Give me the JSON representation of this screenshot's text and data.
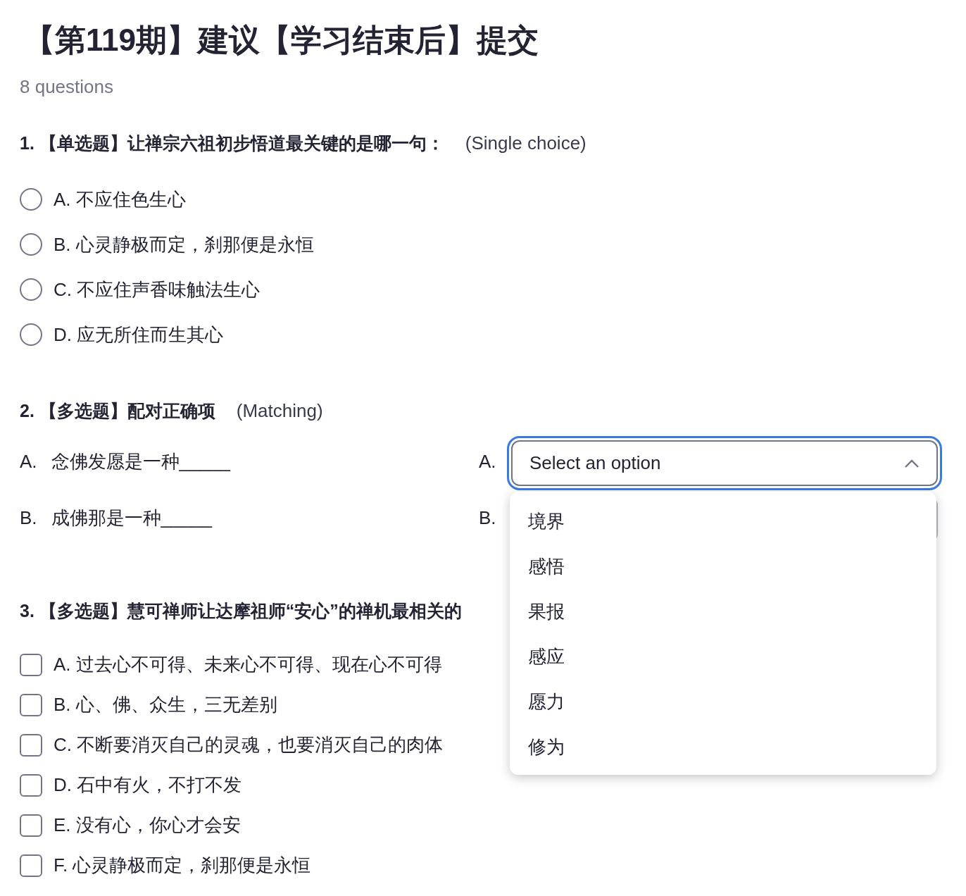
{
  "title": "【第119期】建议【学习结束后】提交",
  "question_count": "8 questions",
  "questions": [
    {
      "kind": "single",
      "text": "1. 【单选题】让禅宗六祖初步悟道最关键的是哪一句：",
      "type_label": "(Single choice)",
      "options": [
        {
          "label": "A. 不应住色生心",
          "selected": false
        },
        {
          "label": "B. 心灵静极而定，刹那便是永恒",
          "selected": false
        },
        {
          "label": "C. 不应住声香味触法生心",
          "selected": false
        },
        {
          "label": "D. 应无所住而生其心",
          "selected": false
        }
      ]
    },
    {
      "kind": "matching",
      "text": "2. 【多选题】配对正确项",
      "type_label": "(Matching)",
      "prompts": [
        {
          "letter": "A.",
          "text": "念佛发愿是一种_____"
        },
        {
          "letter": "B.",
          "text": "成佛那是一种_____"
        }
      ],
      "answers": [
        {
          "letter": "A.",
          "placeholder": "Select an option",
          "expanded": true,
          "menu": [
            "境界",
            "感悟",
            "果报",
            "感应",
            "愿力",
            "修为"
          ]
        },
        {
          "letter": "B.",
          "expanded": false
        }
      ]
    },
    {
      "kind": "multiple",
      "text": "3. 【多选题】慧可禅师让达摩祖师“安心”的禅机最相关的",
      "options": [
        {
          "label": "A. 过去心不可得、未来心不可得、现在心不可得",
          "checked": false
        },
        {
          "label": "B. 心、佛、众生，三无差别",
          "checked": false
        },
        {
          "label": "C. 不断要消灭自己的灵魂，也要消灭自己的肉体",
          "checked": false
        },
        {
          "label": "D. 石中有火，不打不发",
          "checked": false
        },
        {
          "label": "E. 没有心，你心才会安",
          "checked": false
        },
        {
          "label": "F. 心灵静极而定，刹那便是永恒",
          "checked": false
        }
      ]
    }
  ]
}
